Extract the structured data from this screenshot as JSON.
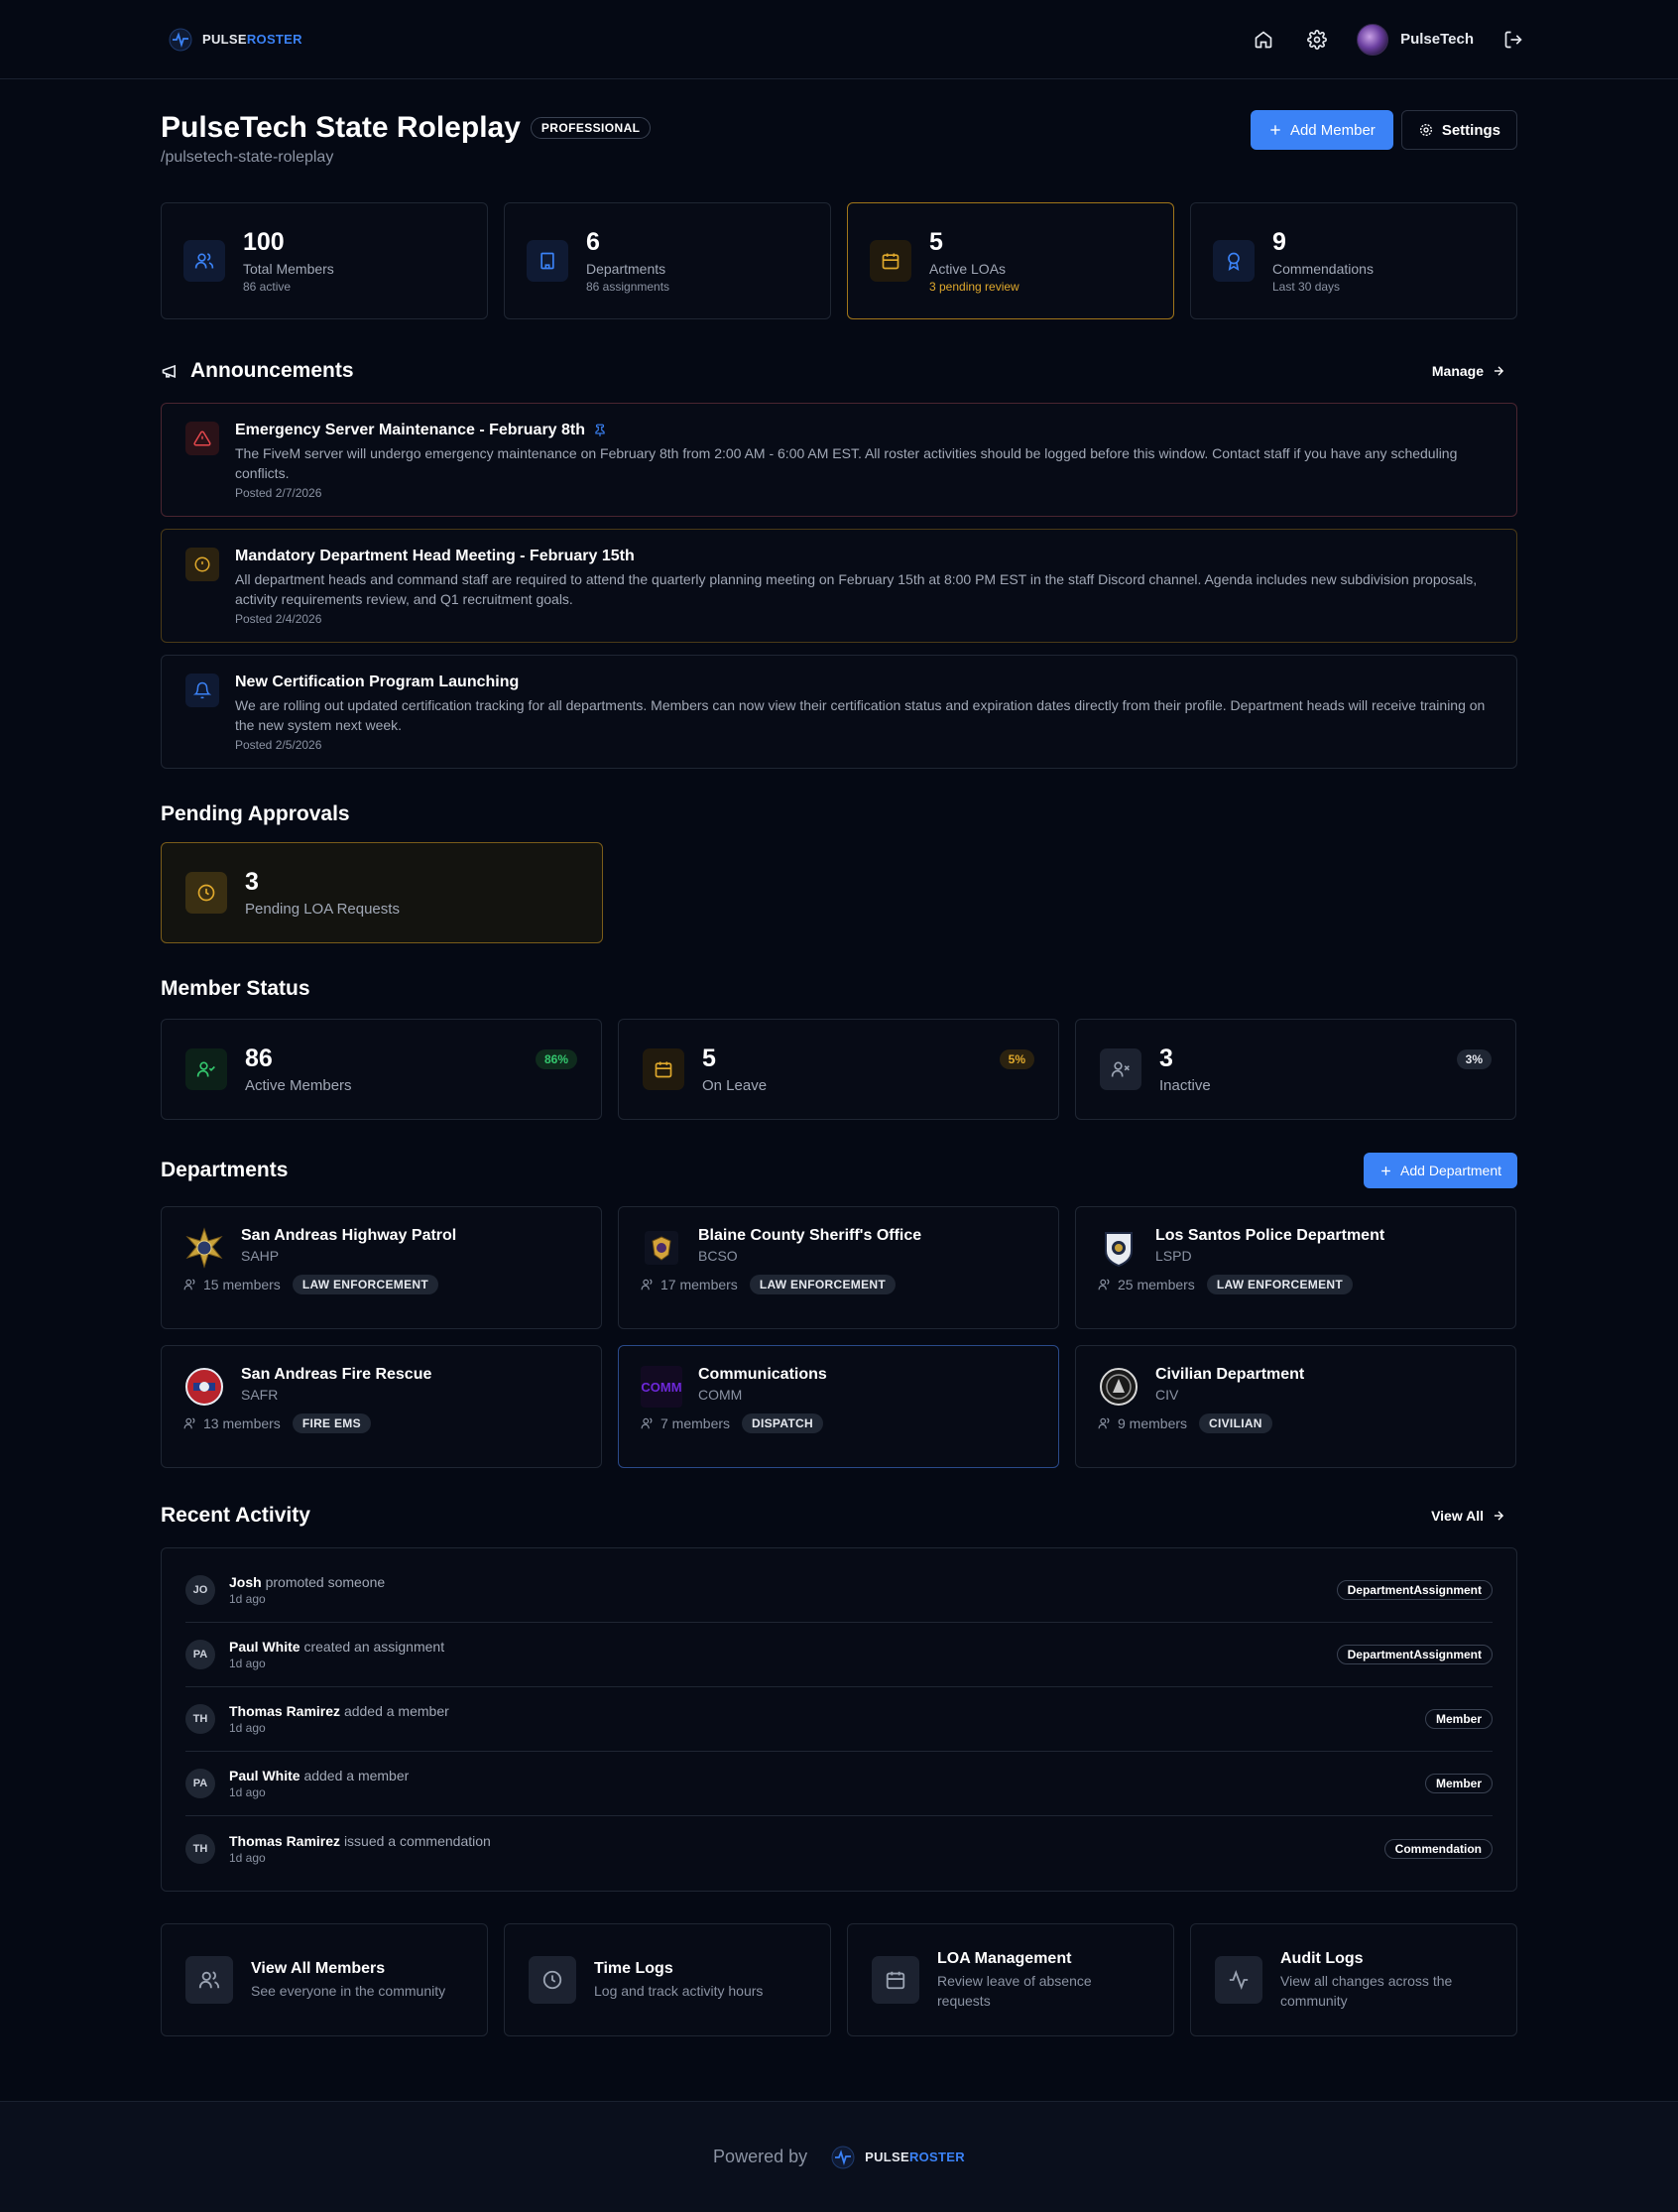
{
  "nav": {
    "brand_part1": "PULSE",
    "brand_part2": "ROSTER",
    "username": "PulseTech"
  },
  "header": {
    "title": "PulseTech State Roleplay",
    "plan_badge": "PROFESSIONAL",
    "slug": "/pulsetech-state-roleplay",
    "add_member_label": "Add Member",
    "settings_label": "Settings"
  },
  "stats": [
    {
      "value": "100",
      "label": "Total Members",
      "sub": "86 active",
      "icon": "users-icon"
    },
    {
      "value": "6",
      "label": "Departments",
      "sub": "86 assignments",
      "icon": "building-icon"
    },
    {
      "value": "5",
      "label": "Active LOAs",
      "sub": "3 pending review",
      "icon": "calendar-icon"
    },
    {
      "value": "9",
      "label": "Commendations",
      "sub": "Last 30 days",
      "icon": "award-icon"
    }
  ],
  "announcements": {
    "title": "Announcements",
    "manage_label": "Manage",
    "items": [
      {
        "title": "Emergency Server Maintenance - February 8th",
        "body": "The FiveM server will undergo emergency maintenance on February 8th from 2:00 AM - 6:00 AM EST. All roster activities should be logged before this window. Contact staff if you have any scheduling conflicts.",
        "date": "Posted 2/7/2026",
        "icon": "alert-triangle-icon",
        "pinned": true
      },
      {
        "title": "Mandatory Department Head Meeting - February 15th",
        "body": "All department heads and command staff are required to attend the quarterly planning meeting on February 15th at 8:00 PM EST in the staff Discord channel. Agenda includes new subdivision proposals, activity requirements review, and Q1 recruitment goals.",
        "date": "Posted 2/4/2026",
        "icon": "alert-circle-icon"
      },
      {
        "title": "New Certification Program Launching",
        "body": "We are rolling out updated certification tracking for all departments. Members can now view their certification status and expiration dates directly from their profile. Department heads will receive training on the new system next week.",
        "date": "Posted 2/5/2026",
        "icon": "bell-icon"
      }
    ]
  },
  "pending": {
    "title": "Pending Approvals",
    "value": "3",
    "label": "Pending LOA Requests"
  },
  "member_status": {
    "title": "Member Status",
    "items": [
      {
        "value": "86",
        "label": "Active Members",
        "pct": "86%"
      },
      {
        "value": "5",
        "label": "On Leave",
        "pct": "5%"
      },
      {
        "value": "3",
        "label": "Inactive",
        "pct": "3%"
      }
    ]
  },
  "departments": {
    "title": "Departments",
    "add_label": "Add Department",
    "items": [
      {
        "name": "San Andreas Highway Patrol",
        "code": "SAHP",
        "members": "15 members",
        "tag": "LAW ENFORCEMENT"
      },
      {
        "name": "Blaine County Sheriff's Office",
        "code": "BCSO",
        "members": "17 members",
        "tag": "LAW ENFORCEMENT"
      },
      {
        "name": "Los Santos Police Department",
        "code": "LSPD",
        "members": "25 members",
        "tag": "LAW ENFORCEMENT"
      },
      {
        "name": "San Andreas Fire Rescue",
        "code": "SAFR",
        "members": "13 members",
        "tag": "FIRE EMS"
      },
      {
        "name": "Communications",
        "code": "COMM",
        "logo_text": "COMM",
        "members": "7 members",
        "tag": "DISPATCH"
      },
      {
        "name": "Civilian Department",
        "code": "CIV",
        "members": "9 members",
        "tag": "CIVILIAN"
      }
    ]
  },
  "activity": {
    "title": "Recent Activity",
    "view_all_label": "View All",
    "items": [
      {
        "initials": "JO",
        "name": "Josh",
        "action": "promoted someone",
        "time": "1d ago",
        "tag": "DepartmentAssignment"
      },
      {
        "initials": "PA",
        "name": "Paul White",
        "action": "created an assignment",
        "time": "1d ago",
        "tag": "DepartmentAssignment"
      },
      {
        "initials": "TH",
        "name": "Thomas Ramirez",
        "action": "added a member",
        "time": "1d ago",
        "tag": "Member"
      },
      {
        "initials": "PA",
        "name": "Paul White",
        "action": "added a member",
        "time": "1d ago",
        "tag": "Member"
      },
      {
        "initials": "TH",
        "name": "Thomas Ramirez",
        "action": "issued a commendation",
        "time": "1d ago",
        "tag": "Commendation"
      }
    ]
  },
  "quick_links": [
    {
      "title": "View All Members",
      "sub": "See everyone in the community"
    },
    {
      "title": "Time Logs",
      "sub": "Log and track activity hours"
    },
    {
      "title": "LOA Management",
      "sub": "Review leave of absence requests"
    },
    {
      "title": "Audit Logs",
      "sub": "View all changes across the community"
    }
  ],
  "footer": {
    "powered_by": "Powered by",
    "brand_part1": "PULSE",
    "brand_part2": "ROSTER"
  },
  "colors": {
    "accent": "#3b82f6",
    "amber": "#e0a92c",
    "green": "#34c76e",
    "background": "#050914"
  }
}
